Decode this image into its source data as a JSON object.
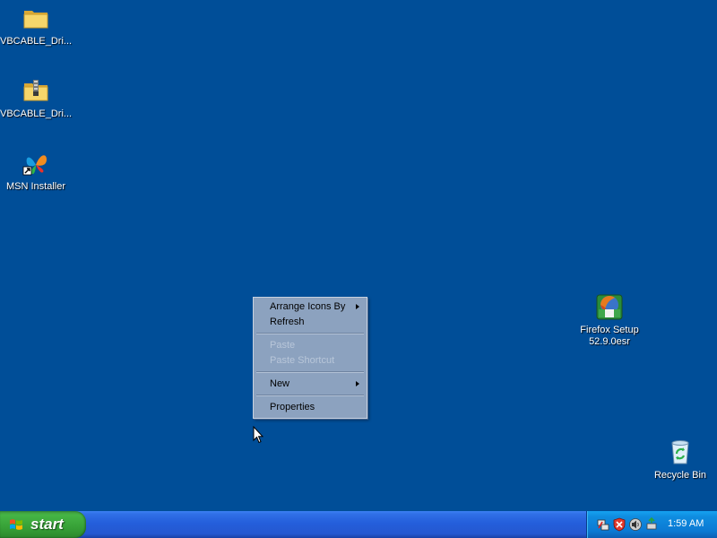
{
  "desktop": {
    "background_color": "#004e98",
    "icons": [
      {
        "label": "VBCABLE_Dri...",
        "icon": "folder-icon"
      },
      {
        "label": "VBCABLE_Dri...",
        "icon": "zip-folder-icon"
      },
      {
        "label": "MSN Installer",
        "icon": "msn-butterfly-icon"
      },
      {
        "label": "Firefox Setup\n52.9.0esr",
        "icon": "firefox-setup-icon"
      },
      {
        "label": "Recycle Bin",
        "icon": "recycle-bin-icon"
      }
    ]
  },
  "context_menu": {
    "items": [
      {
        "label": "Arrange Icons By",
        "submenu": true,
        "enabled": true
      },
      {
        "label": "Refresh",
        "submenu": false,
        "enabled": true
      },
      {
        "label": "Paste",
        "submenu": false,
        "enabled": false
      },
      {
        "label": "Paste Shortcut",
        "submenu": false,
        "enabled": false
      },
      {
        "label": "New",
        "submenu": true,
        "enabled": true
      },
      {
        "label": "Properties",
        "submenu": false,
        "enabled": true
      }
    ]
  },
  "taskbar": {
    "start_label": "start",
    "tray_icons": [
      "network-icon",
      "security-shield-icon",
      "volume-icon",
      "safely-remove-icon"
    ],
    "clock": "1:59 AM"
  }
}
